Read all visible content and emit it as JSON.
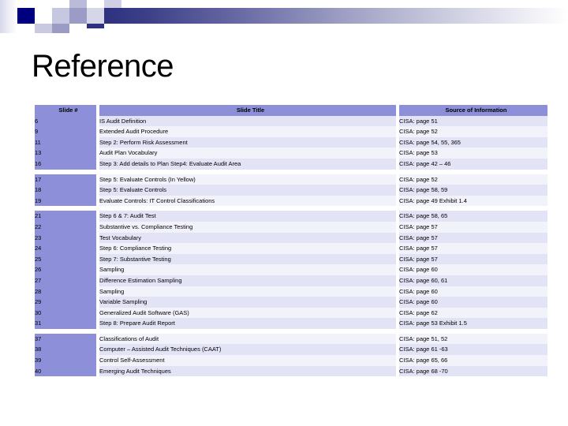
{
  "slide": {
    "title": "Reference",
    "decoration": {
      "accent_dark": "#00007f",
      "accent_bar": "#2e3180",
      "accent_light": "#c6c7e0"
    }
  },
  "table": {
    "header": {
      "slide_number": "Slide #",
      "slide_title": "Slide Title",
      "source": "Source of Information"
    },
    "header_bg": "#8d8fd8",
    "row_bg_odd": "#e3e3f6",
    "row_bg_even": "#f2f2fb",
    "groups": [
      {
        "rows": [
          {
            "num": "6",
            "title": "IS Audit Definition",
            "source": "CISA: page 51"
          },
          {
            "num": "9",
            "title": "Extended Audit Procedure",
            "source": "CISA: page 52"
          },
          {
            "num": "11",
            "title": "Step 2: Perform Risk Assessment",
            "source": "CISA: page 54, 55, 365"
          },
          {
            "num": "13",
            "title": "Audit Plan Vocabulary",
            "source": "CISA: page 53"
          },
          {
            "num": "16",
            "title": "Step 3: Add details to Plan Step4: Evaluate Audit Area",
            "source": "CISA: page 42 – 46"
          }
        ]
      },
      {
        "rows": [
          {
            "num": "17",
            "title": "Step 5: Evaluate Controls (In Yellow)",
            "source": "CISA: page 52"
          },
          {
            "num": "18",
            "title": "Step 5: Evaluate Controls",
            "source": "CISA: page 58, 59"
          },
          {
            "num": "19",
            "title": "Evaluate Controls: IT Control Classifications",
            "source": "CISA: page 49 Exhibit 1.4"
          }
        ]
      },
      {
        "rows": [
          {
            "num": "21",
            "title": "Step 6 & 7: Audit Test",
            "source": "CISA: page 58, 65"
          },
          {
            "num": "22",
            "title": "Substantive vs. Compliance Testing",
            "source": "CISA: page 57"
          },
          {
            "num": "23",
            "title": "Test Vocabulary",
            "source": "CISA: page 57"
          },
          {
            "num": "24",
            "title": "Step 6: Compliance Testing",
            "source": "CISA: page 57"
          },
          {
            "num": "25",
            "title": "Step 7: Substantive Testing",
            "source": "CISA: page 57"
          },
          {
            "num": "26",
            "title": "Sampling",
            "source": "CISA: page 60"
          },
          {
            "num": "27",
            "title": "Difference Estimation Sampling",
            "source": "CISA: page 60, 61"
          },
          {
            "num": "28",
            "title": "Sampling",
            "source": "CISA: page 60"
          },
          {
            "num": "29",
            "title": "Variable Sampling",
            "source": "CISA: page 60"
          },
          {
            "num": "30",
            "title": "Generalized Audit Software (GAS)",
            "source": "CISA: page 62"
          },
          {
            "num": "31",
            "title": "Step 8: Prepare Audit Report",
            "source": "CISA: page 53 Exhibit 1.5"
          }
        ]
      },
      {
        "rows": [
          {
            "num": "37",
            "title": "Classifications of Audit",
            "source": "CISA: page 51, 52"
          },
          {
            "num": "38",
            "title": "Computer – Assisted Audit Techniques (CAAT)",
            "source": "CISA: page 61 -63"
          },
          {
            "num": "39",
            "title": "Control Self-Assessment",
            "source": "CISA: page 65, 66"
          },
          {
            "num": "40",
            "title": "Emerging Audit Techniques",
            "source": "CISA: page 68 -70"
          }
        ]
      }
    ]
  }
}
